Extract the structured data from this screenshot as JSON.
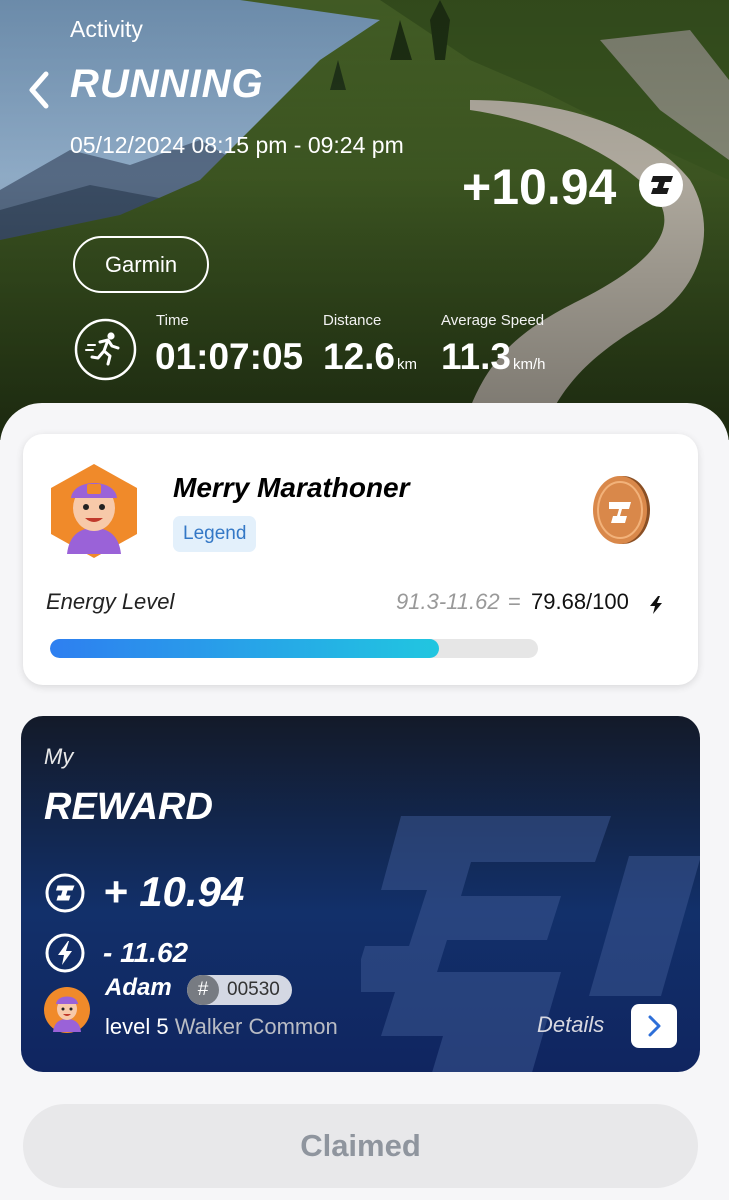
{
  "header": {
    "section": "Activity",
    "title": "RUNNING",
    "datetime": "05/12/2024 08:15 pm - 09:24 pm",
    "earned": "+10.94",
    "source": "Garmin"
  },
  "stats": [
    {
      "label": "Time",
      "value": "01:07:05",
      "unit": ""
    },
    {
      "label": "Distance",
      "value": "12.6",
      "unit": "km"
    },
    {
      "label": "Average Speed",
      "value": "11.3",
      "unit": "km/h"
    }
  ],
  "profile": {
    "nickname": "Merry Marathoner",
    "badge": "Legend",
    "energy_label": "Energy Level",
    "energy_calc": "91.3-11.62",
    "energy_eq": "=",
    "energy_result": "79.68/100",
    "energy_fraction": 0.7968
  },
  "reward": {
    "my": "My",
    "title": "REWARD",
    "plus": "+ 10.94",
    "minus": "- 11.62",
    "user_name": "Adam",
    "user_id_symbol": "#",
    "user_id": "00530",
    "level": "level 5",
    "level_desc": "Walker Common",
    "details": "Details"
  },
  "claim_button": "Claimed",
  "icons": {
    "back": "chevron-left-icon",
    "token": "token-coin-icon",
    "run": "running-person-icon",
    "bolt": "lightning-bolt-icon",
    "details": "chevron-right-icon"
  },
  "colors": {
    "accent_blue": "#2e7ff0",
    "accent_cyan": "#21c6e0",
    "badge_text": "#3478c6",
    "reward_bg": "#12306a",
    "coin": "#d9884a"
  }
}
